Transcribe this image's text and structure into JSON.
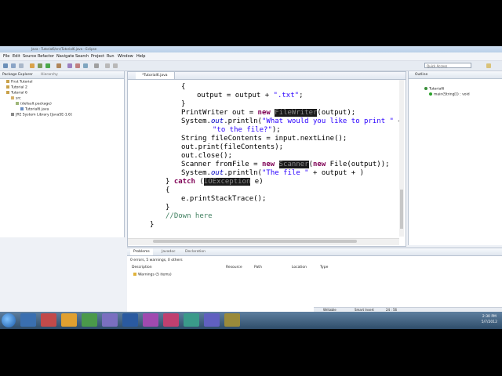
{
  "window": {
    "title": "Java - Tutorial6/src/Tutorial6.java - Eclipse"
  },
  "menu": [
    "File",
    "Edit",
    "Source",
    "Refactor",
    "Navigate",
    "Search",
    "Project",
    "Run",
    "Window",
    "Help"
  ],
  "quick_access": {
    "placeholder": "Quick Access"
  },
  "package_explorer": {
    "tab_label": "Package Explorer",
    "tab2_label": "Hierarchy",
    "items": [
      "First Tutorial",
      "Tutorial 2",
      "Tutorial 6",
      "src",
      "(default package)",
      "Tutorial6.java",
      "JRE System Library [JavaSE-1.6]"
    ]
  },
  "editor": {
    "tab_label": "*Tutorial6.java",
    "lines": [
      "{",
      "output = output + \".txt\";",
      "}",
      "PrintWriter out = new ",
      "System.out.println(\"What would you like to print \" +",
      "\"to the file?\");",
      "String fileContents = input.nextLine();",
      "out.print(fileContents);",
      "out.close();",
      "Scanner fromFile = new ",
      "System.out.println(\"The file \" + output + )",
      "} catch (",
      "{",
      "e.printStackTrace();",
      "}",
      "//Down here",
      "}"
    ]
  },
  "outline": {
    "tab_label": "Outline",
    "items": [
      "Tutorial6",
      "main(String[]) : void"
    ]
  },
  "problems": {
    "tabs": [
      "Problems",
      "Javadoc",
      "Declaration"
    ],
    "summary": "0 errors, 5 warnings, 0 others",
    "columns": [
      "Description",
      "Resource",
      "Path",
      "Location",
      "Type"
    ],
    "rows": [
      "Warnings (5 items)"
    ]
  },
  "status_bar": {
    "writable": "Writable",
    "insert_mode": "Smart Insert",
    "position": "24 : 56"
  },
  "clock": {
    "time": "2:30 PM",
    "date": "5/7/2012"
  }
}
